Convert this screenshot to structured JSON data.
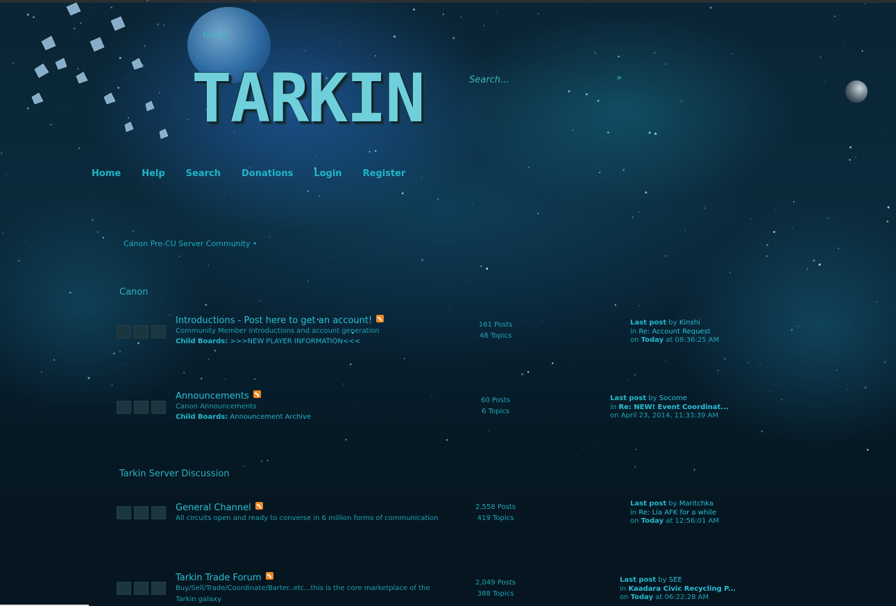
{
  "header": {
    "news_label": "News:",
    "logo_text": "TARKIN",
    "search": {
      "placeholder": "Search...",
      "go_label": "»"
    }
  },
  "nav": {
    "items": [
      "Home",
      "Help",
      "Search",
      "Donations",
      "Login",
      "Register"
    ]
  },
  "breadcrumb": "Canon Pre-CU Server Community",
  "categories": [
    {
      "name": "Canon",
      "boards": [
        {
          "title": "Introductions - Post here to get an account!",
          "description": "Community Member Introductions and account generation",
          "child_label": "Child Boards:",
          "child_boards": ">>>NEW PLAYER INFORMATION<<<",
          "posts": "161 Posts",
          "topics": "48 Topics",
          "last_post_label": "Last post",
          "by": "by",
          "last_user": "Kinshi",
          "in": "in",
          "last_topic": "Re: Account Request",
          "on": "on",
          "last_date_bold": "Today",
          "last_time": "at 08:36:25 AM"
        },
        {
          "title": "Announcements",
          "description": "Canon Announcements",
          "child_label": "Child Boards:",
          "child_boards": "Announcement Archive",
          "posts": "60 Posts",
          "topics": "6 Topics",
          "last_post_label": "Last post",
          "by": "by",
          "last_user": "Socome",
          "in": "in",
          "last_topic": "Re: NEW! Event Coordinat...",
          "on": "on",
          "last_date_bold": "",
          "last_time": "April 23, 2014, 11:33:39 AM"
        }
      ]
    },
    {
      "name": "Tarkin Server Discussion",
      "boards": [
        {
          "title": "General Channel",
          "description": "All circuits open and ready to converse in 6 million forms of communication",
          "posts": "2,558 Posts",
          "topics": "419 Topics",
          "last_post_label": "Last post",
          "by": "by",
          "last_user": "Maritchka",
          "in": "in",
          "last_topic": "Re: Lia AFK for a while",
          "on": "on",
          "last_date_bold": "Today",
          "last_time": "at 12:56:01 AM"
        },
        {
          "title": "Tarkin Trade Forum",
          "description": "Buy/Sell/Trade/Coordinate/Barter..etc...this is the core marketplace of the",
          "description2": "Tarkin galaxy",
          "posts": "2,049 Posts",
          "topics": "388 Topics",
          "last_post_label": "Last post",
          "by": "by",
          "last_user": "SEE",
          "in": "in",
          "last_topic": "Kaadara Civic Recycling P...",
          "on": "on",
          "last_date_bold": "Today",
          "last_time": "at 06:22:28 AM"
        }
      ]
    }
  ],
  "colors": {
    "accent": "#1fb6c9",
    "background": "#05141d",
    "rss": "#f08a24"
  }
}
